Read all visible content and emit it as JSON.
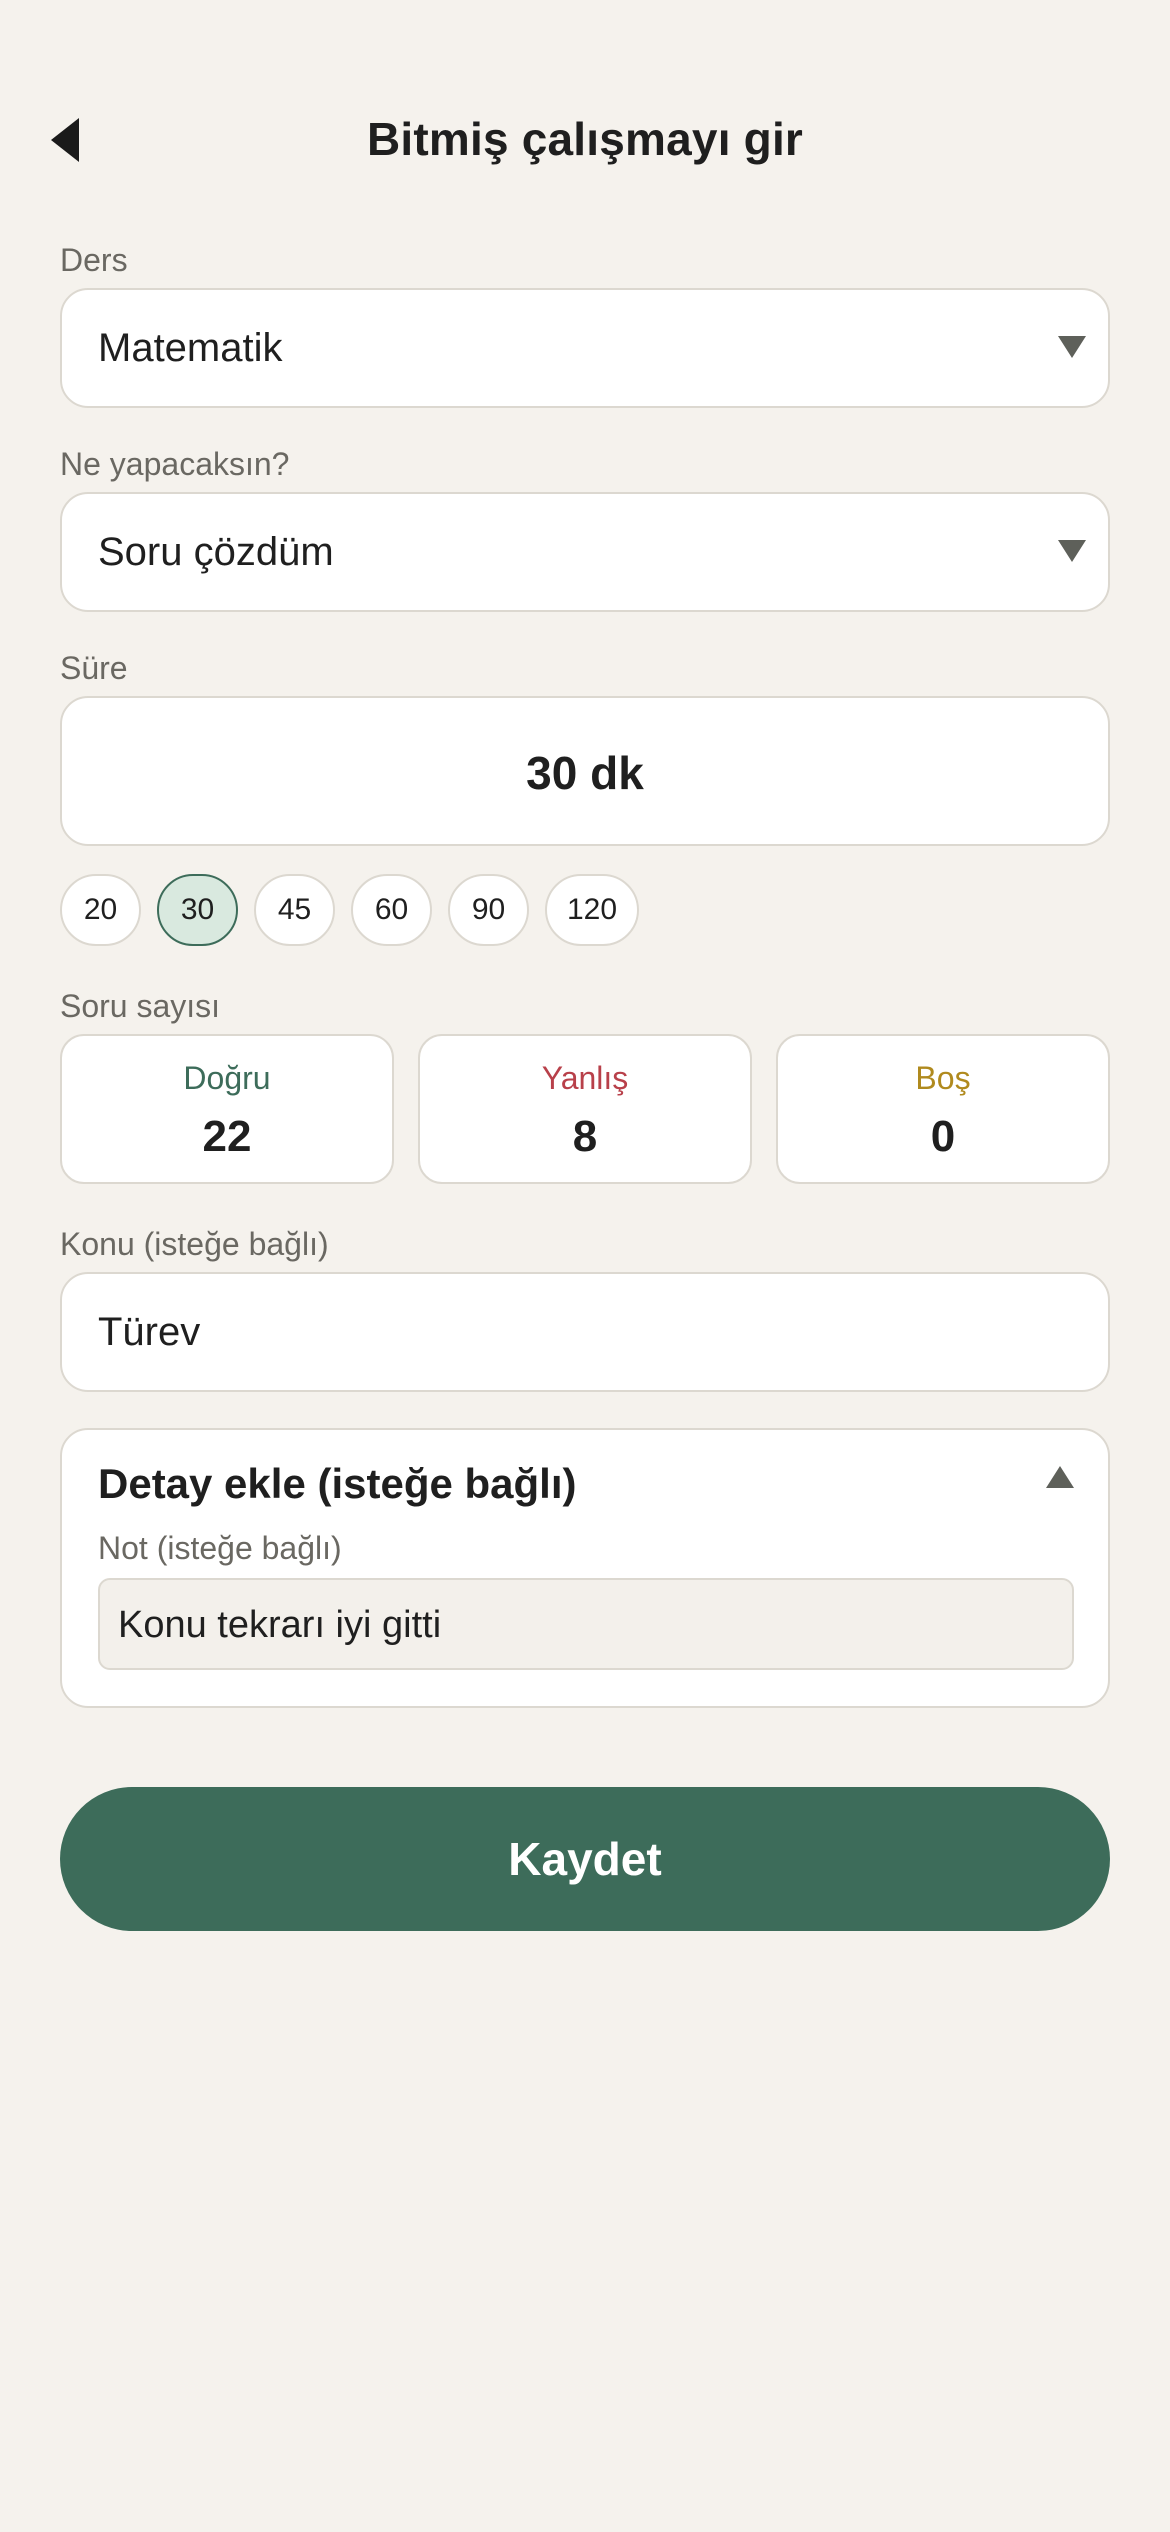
{
  "header": {
    "title": "Bitmiş çalışmayı gir",
    "back_icon": "back-arrow-icon"
  },
  "subject": {
    "label": "Ders",
    "value": "Matematik"
  },
  "activity": {
    "label": "Ne yapacaksın?",
    "value": "Soru çözdüm"
  },
  "duration": {
    "label": "Süre",
    "value": "30 dk",
    "presets": [
      "20",
      "30",
      "45",
      "60",
      "90",
      "120"
    ],
    "selected": "30"
  },
  "questions": {
    "label": "Soru sayısı",
    "correct": {
      "label": "Doğru",
      "value": "22",
      "color": "#3d6c5a"
    },
    "wrong": {
      "label": "Yanlış",
      "value": "8",
      "color": "#b8404a"
    },
    "blank": {
      "label": "Boş",
      "value": "0",
      "color": "#b08a1e"
    }
  },
  "topic": {
    "label": "Konu (isteğe bağlı)",
    "value": "Türev"
  },
  "details": {
    "title": "Detay ekle (isteğe bağlı)",
    "expanded": true,
    "note_label": "Not (isteğe bağlı)",
    "note_value": "Konu tekrarı iyi gitti"
  },
  "save": {
    "label": "Kaydet"
  },
  "colors": {
    "background": "#f5f2ed",
    "accent": "#3d6c5a",
    "chip_selected": "#d9e9df"
  }
}
